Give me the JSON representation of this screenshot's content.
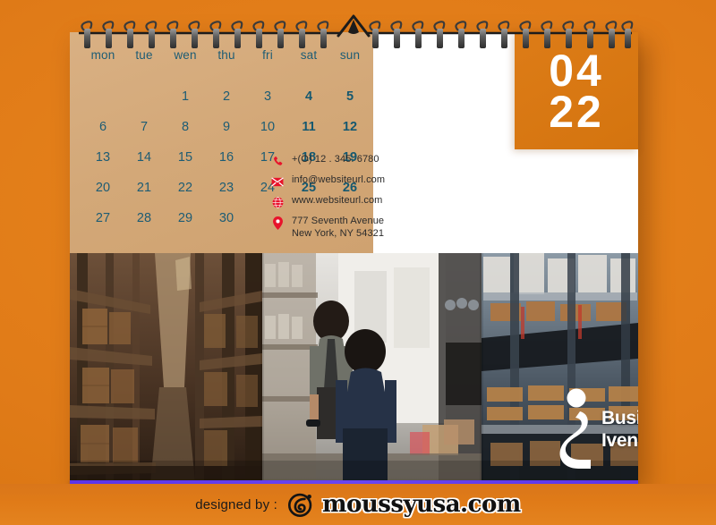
{
  "page": {
    "background_color": "#e07b18",
    "accent_color": "#e07b18",
    "card_beige": "#d3a878",
    "date_text_color": "#1d5c74",
    "icon_red": "#e8132b",
    "purple_line_color": "#5b34e8"
  },
  "calendar": {
    "weekday_headers": [
      "mon",
      "tue",
      "wen",
      "thu",
      "fri",
      "sat",
      "sun"
    ],
    "weeks": [
      [
        "",
        "",
        "1",
        "2",
        "3",
        "4",
        "5"
      ],
      [
        "6",
        "7",
        "8",
        "9",
        "10",
        "11",
        "12"
      ],
      [
        "13",
        "14",
        "15",
        "16",
        "17",
        "18",
        "19"
      ],
      [
        "20",
        "21",
        "22",
        "23",
        "24",
        "25",
        "26"
      ],
      [
        "27",
        "28",
        "29",
        "30",
        "",
        "",
        ""
      ]
    ],
    "weekend_column_indices": [
      5,
      6
    ]
  },
  "date_badge": {
    "month": "04",
    "year_short": "22"
  },
  "contact": {
    "phone": {
      "icon": "phone-icon",
      "value": "+(O) 12 . 345. 6780"
    },
    "email": {
      "icon": "envelope-icon",
      "value": "info@websiteurl.com"
    },
    "website": {
      "icon": "globe-icon",
      "value": "www.websiteurl.com"
    },
    "address": {
      "icon": "map-pin-icon",
      "value": "777 Seventh Avenue\nNew York, NY 54321"
    }
  },
  "brand_logo": {
    "icon": "business-inventory-figure-icon",
    "line1": "Business",
    "line2": "Iventory"
  },
  "footer": {
    "designed_by_label": "designed by :",
    "logo_icon": "moussy-swirl-icon",
    "site_name": "moussyusa.com"
  },
  "photo": {
    "description": "warehouse-aisle-workers-photo"
  }
}
